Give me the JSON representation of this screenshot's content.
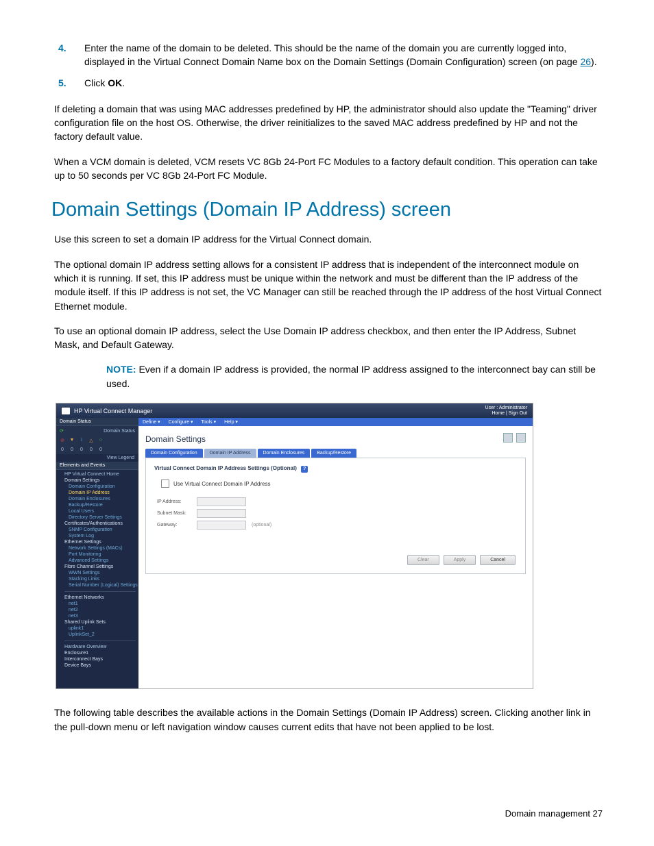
{
  "steps": {
    "s4_num": "4.",
    "s4_text_pre": "Enter the name of the domain to be deleted. This should be the name of the domain you are currently logged into, displayed in the Virtual Connect Domain Name box on the Domain Settings (Domain Configuration) screen (on page ",
    "s4_link": "26",
    "s4_text_post": ").",
    "s5_num": "5.",
    "s5_text_pre": "Click ",
    "s5_bold": "OK",
    "s5_text_post": "."
  },
  "paras": {
    "p1": "If deleting a domain that was using MAC addresses predefined by HP, the administrator should also update the \"Teaming\" driver configuration file on the host OS. Otherwise, the driver reinitializes to the saved MAC address predefined by HP and not the factory default value.",
    "p2": "When a VCM domain is deleted, VCM resets VC 8Gb 24-Port FC Modules to a factory default condition. This operation can take up to 50 seconds per VC 8Gb 24-Port FC Module.",
    "h1": "Domain Settings (Domain IP Address) screen",
    "p3": "Use this screen to set a domain IP address for the Virtual Connect domain.",
    "p4": "The optional domain IP address setting allows for a consistent IP address that is independent of the interconnect module on which it is running. If set, this IP address must be unique within the network and must be different than the IP address of the module itself. If this IP address is not set, the VC Manager can still be reached through the IP address of the host Virtual Connect Ethernet module.",
    "p5": "To use an optional domain IP address, select the Use Domain IP address checkbox, and then enter the IP Address, Subnet Mask, and Default Gateway.",
    "note_label": "NOTE:",
    "note_text": "  Even if a domain IP address is provided, the normal IP address assigned to the interconnect bay can still be used.",
    "p6": "The following table describes the available actions in the Domain Settings (Domain IP Address) screen. Clicking another link in the pull-down menu or left navigation window causes current edits that have not been applied to be lost."
  },
  "ui": {
    "title": "HP Virtual Connect Manager",
    "user_line1": "User : Administrator",
    "user_line2": "Home | Sign Out",
    "menu": {
      "define": "Define ▾",
      "configure": "Configure ▾",
      "tools": "Tools ▾",
      "help": "Help ▾"
    },
    "sidebar": {
      "domain_status": "Domain Status",
      "status_label": "Domain Status",
      "counts": {
        "a": "0",
        "b": "0",
        "c": "0",
        "d": "0",
        "e": "0"
      },
      "view_legend": "View Legend",
      "elements": "Elements and Events",
      "home": "HP Virtual Connect Home",
      "domain_settings": "Domain Settings",
      "domain_config": "Domain Configuration",
      "domain_ip": "Domain IP Address",
      "domain_enclosures": "Domain Enclosures",
      "backup_restore": "Backup/Restore",
      "local_users": "Local Users",
      "directory": "Directory Server Settings",
      "certs": "Certificates/Authentications",
      "snmp": "SNMP Configuration",
      "syslog": "System Log",
      "ethernet_settings": "Ethernet Settings",
      "net_mac": "Network Settings (MACs)",
      "port_mon": "Port Monitoring",
      "advanced": "Advanced Settings",
      "fc_settings": "Fibre Channel Settings",
      "wwn": "WWN Settings",
      "stacking": "Stacking Links",
      "serial": "Serial Number (Logical) Settings",
      "eth_networks": "Ethernet Networks",
      "net1": "net1",
      "net2": "net2",
      "net3": "net3",
      "shared_uplink": "Shared Uplink Sets",
      "uplink1": "uplink1",
      "uplinkset2": "UplinkSet_2",
      "hw_overview": "Hardware Overview",
      "enclosure1": "Enclosure1",
      "interconnect_bays": "Interconnect Bays",
      "device_bays": "Device Bays"
    },
    "main": {
      "page_title": "Domain Settings",
      "tabs": {
        "config": "Domain Configuration",
        "ip": "Domain IP Address",
        "enclosures": "Domain Enclosures",
        "backup": "Backup/Restore"
      },
      "panel_title": "Virtual Connect Domain IP Address Settings  (Optional)",
      "checkbox_label": "Use Virtual Connect Domain IP Address",
      "ip_label": "IP Address:",
      "subnet_label": "Subnet Mask:",
      "gateway_label": "Gateway:",
      "gateway_hint": "(optional)",
      "btn_clear": "Clear",
      "btn_apply": "Apply",
      "btn_cancel": "Cancel"
    }
  },
  "footer": {
    "text": "Domain management   27"
  }
}
